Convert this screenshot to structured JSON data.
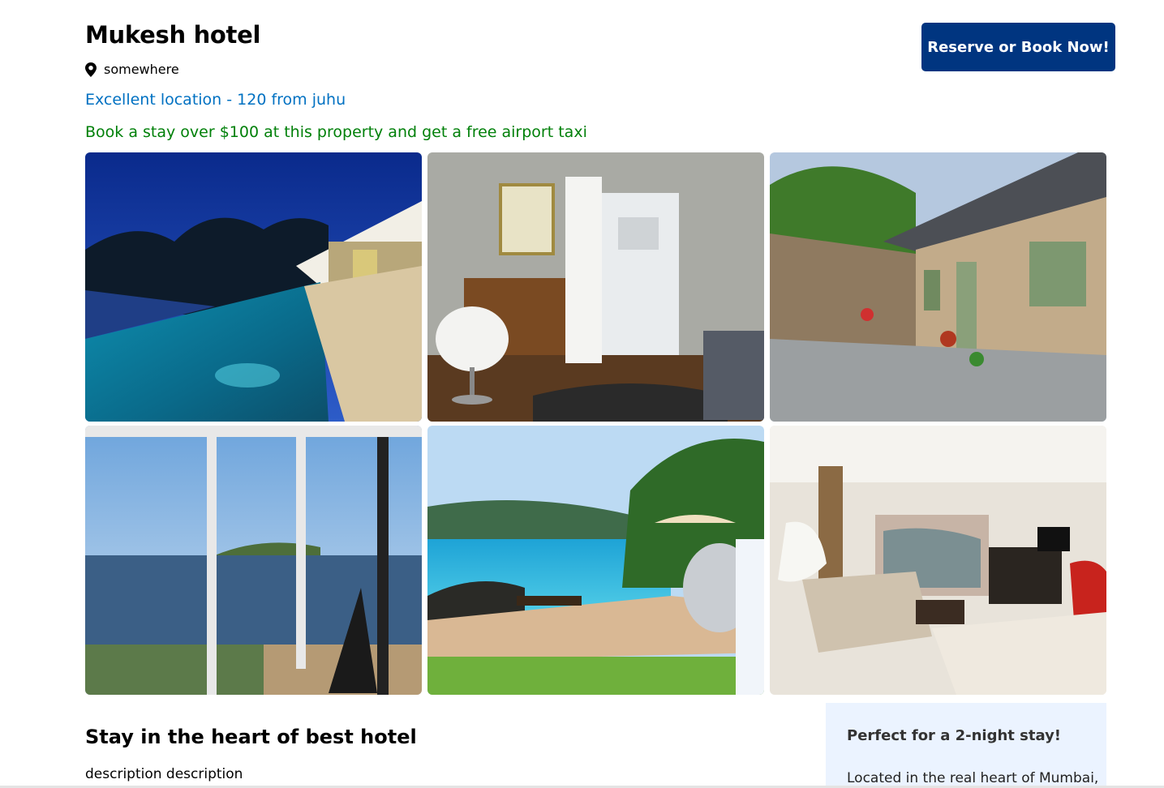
{
  "hotel": {
    "name": "Mukesh hotel",
    "address": "somewhere",
    "distance": "Excellent location - 120 from juhu",
    "deal": "Book a stay over $100 at this property and get a free airport taxi"
  },
  "actions": {
    "book_label": "Reserve or Book Now!"
  },
  "gallery": {
    "images": [
      {
        "subject": "infinity pool at dusk"
      },
      {
        "subject": "bedroom with armchair and bathroom door"
      },
      {
        "subject": "stone cottage courtyard"
      },
      {
        "subject": "sea view through window"
      },
      {
        "subject": "beach deck with loungers and trailer"
      },
      {
        "subject": "living room with sofa and tv"
      }
    ]
  },
  "details": {
    "title": "Stay in the heart of best hotel",
    "description": "description description"
  },
  "highlight": {
    "title": "Perfect for a 2-night stay!",
    "text": "Located in the real heart of Mumbai,"
  },
  "colors": {
    "brand": "#003580",
    "link": "#0071c2",
    "deal": "#008009",
    "highlight_bg": "#ebf3ff"
  }
}
